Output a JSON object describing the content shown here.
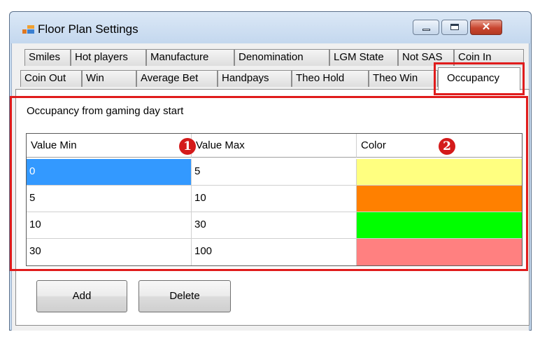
{
  "window": {
    "title": "Floor Plan Settings",
    "close_glyph": "✕"
  },
  "tabs": {
    "row1": [
      "Smiles",
      "Hot players",
      "Manufacture",
      "Denomination",
      "LGM State",
      "Not SAS",
      "Coin In"
    ],
    "row2": [
      "Coin Out",
      "Win",
      "Average Bet",
      "Handpays",
      "Theo Hold",
      "Theo Win",
      "Occupancy"
    ],
    "selected": "Occupancy"
  },
  "panel": {
    "label": "Occupancy from gaming day start"
  },
  "grid": {
    "columns": [
      "Value Min",
      "Value Max",
      "Color"
    ],
    "rows": [
      {
        "min": "0",
        "max": "5",
        "color": "#ffff80"
      },
      {
        "min": "5",
        "max": "10",
        "color": "#ff8000"
      },
      {
        "min": "10",
        "max": "30",
        "color": "#00ff00"
      },
      {
        "min": "30",
        "max": "100",
        "color": "#ff8080"
      }
    ]
  },
  "annotations": {
    "badge1": "1",
    "badge2": "2",
    "highlight_color": "#e01c1c"
  },
  "buttons": {
    "add": "Add",
    "delete": "Delete"
  },
  "icons": {
    "app": "app-window-icon",
    "minimize": "minimize-icon",
    "maximize": "maximize-icon",
    "close": "close-icon"
  }
}
